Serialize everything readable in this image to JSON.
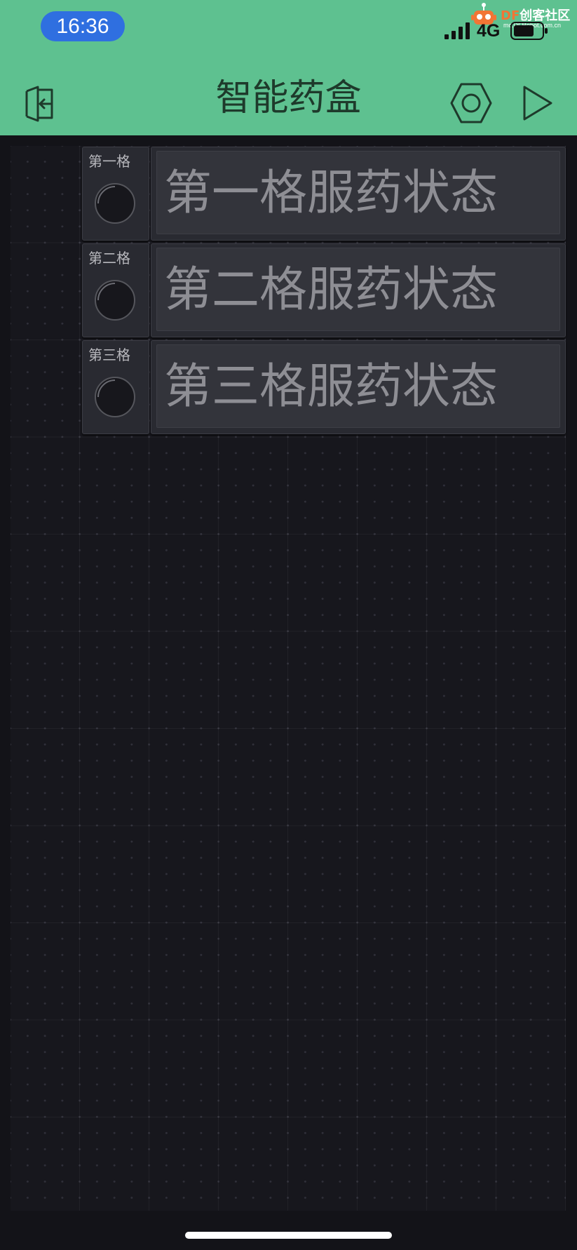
{
  "status_bar": {
    "time": "16:36",
    "network": "4G"
  },
  "watermark": {
    "prefix": "DF",
    "brand": "创客社区",
    "url": "mc.DFRobot.com.cn"
  },
  "header": {
    "title": "智能药盒",
    "background": "#5ec190"
  },
  "widgets": [
    {
      "label": "第一格",
      "status": "第一格服药状态"
    },
    {
      "label": "第二格",
      "status": "第二格服药状态"
    },
    {
      "label": "第三格",
      "status": "第三格服药状态"
    }
  ],
  "icons": {
    "exit": "exit-icon",
    "settings": "hexagon-settings-icon",
    "play": "play-icon",
    "knob": "knob-icon"
  }
}
